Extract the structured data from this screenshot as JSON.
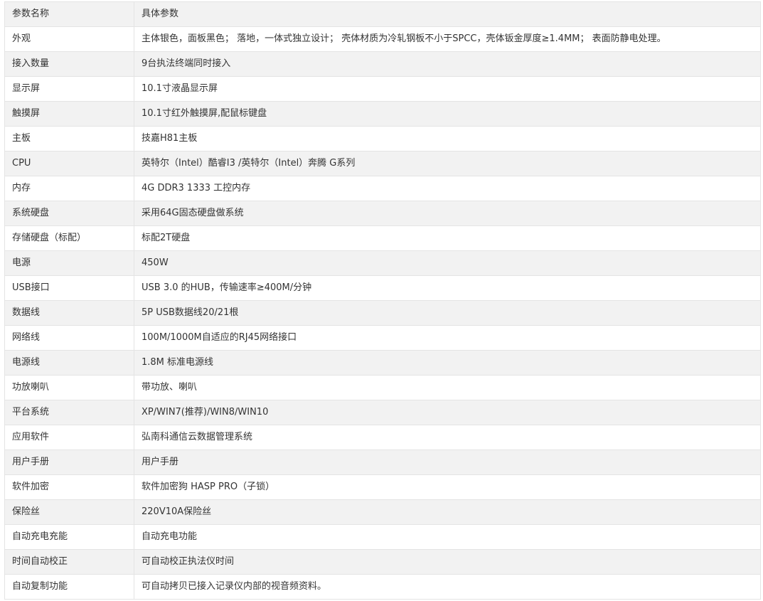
{
  "table": {
    "header": {
      "name": "参数名称",
      "value": "具体参数"
    },
    "rows": [
      {
        "name": "外观",
        "value": "主体银色，面板黑色； 落地，一体式独立设计； 壳体材质为冷轧钢板不小于SPCC，壳体钣金厚度≥1.4MM； 表面防静电处理。"
      },
      {
        "name": "接入数量",
        "value": "9台执法终端同时接入"
      },
      {
        "name": "显示屏",
        "value": "10.1寸液晶显示屏"
      },
      {
        "name": "触摸屏",
        "value": "10.1寸红外触摸屏,配鼠标键盘"
      },
      {
        "name": "主板",
        "value": "技嘉H81主板"
      },
      {
        "name": "CPU",
        "value": "英特尔（Intel）酷睿I3 /英特尔（Intel）奔腾 G系列"
      },
      {
        "name": "内存",
        "value": "4G DDR3 1333 工控内存"
      },
      {
        "name": "系统硬盘",
        "value": "采用64G固态硬盘做系统"
      },
      {
        "name": "存储硬盘（标配）",
        "value": "标配2T硬盘"
      },
      {
        "name": "电源",
        "value": "450W"
      },
      {
        "name": "USB接口",
        "value": "USB 3.0 的HUB，传输速率≥400M/分钟"
      },
      {
        "name": "数据线",
        "value": "5P USB数据线20/21根"
      },
      {
        "name": "网络线",
        "value": "100M/1000M自适应的RJ45网络接口"
      },
      {
        "name": "电源线",
        "value": "1.8M 标准电源线"
      },
      {
        "name": "功放喇叭",
        "value": "带功放、喇叭"
      },
      {
        "name": "平台系统",
        "value": "XP/WIN7(推荐)/WIN8/WIN10"
      },
      {
        "name": "应用软件",
        "value": "弘南科通信云数据管理系统"
      },
      {
        "name": "用户手册",
        "value": "用户手册"
      },
      {
        "name": "软件加密",
        "value": "软件加密狗 HASP PRO（子锁）"
      },
      {
        "name": "保险丝",
        "value": "220V10A保险丝"
      },
      {
        "name": "自动充电充能",
        "value": "自动充电功能"
      },
      {
        "name": "时间自动校正",
        "value": "可自动校正执法仪时间"
      },
      {
        "name": "自动复制功能",
        "value": "可自动拷贝已接入记录仪内部的视音频资料。"
      }
    ]
  }
}
